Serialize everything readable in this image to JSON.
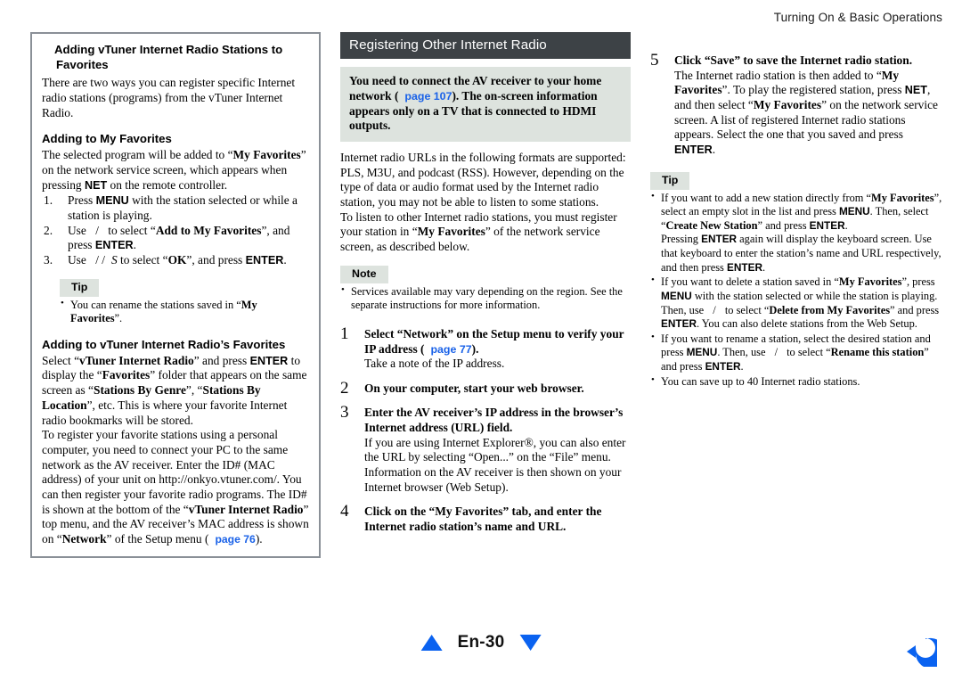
{
  "running_header": "Turning On & Basic Operations",
  "left_column": {
    "heading": "Adding vTuner Internet Radio Stations to Favorites",
    "intro": "There are two ways you can register specific Internet radio stations (programs) from the vTuner Internet Radio.",
    "sub1_heading": "Adding to My Favorites",
    "sub1_intro_a": "The selected program will be added to “",
    "sub1_intro_b": "My Favorites",
    "sub1_intro_c": "” on the network service screen, which appears when pressing ",
    "sub1_intro_d": "NET",
    "sub1_intro_e": " on the remote controller.",
    "steps": [
      {
        "pre": "Press ",
        "kbd": "MENU",
        "post": " with the station selected or while a station is playing."
      },
      {
        "pre": "Use ",
        "arrows": "/",
        "mid": " to select “",
        "bold": "Add to My Favorites",
        "post": "”, and press ",
        "kbd": "ENTER",
        "tail": "."
      },
      {
        "pre": "Use ",
        "arrows": "/ /",
        "arrows2": "S",
        "mid": " to select “",
        "bold": "OK",
        "post": "”, and press ",
        "kbd": "ENTER",
        "tail": "."
      }
    ],
    "tip_badge": "Tip",
    "tip_bullet_a": "You can rename the stations saved in “",
    "tip_bullet_b": "My Favorites",
    "tip_bullet_c": "”.",
    "sub2_heading": "Adding to vTuner Internet Radio’s Favorites",
    "sub2_p1_a": "Select “",
    "sub2_p1_b": "vTuner Internet Radio",
    "sub2_p1_c": "” and press ",
    "sub2_p1_d": "ENTER",
    "sub2_p1_e": " to display the “",
    "sub2_p1_f": "Favorites",
    "sub2_p1_g": "” folder that appears on the same screen as “",
    "sub2_p1_h": "Stations By Genre",
    "sub2_p1_i": "”, “",
    "sub2_p1_j": "Stations By Location",
    "sub2_p1_k": "”, etc. This is where your favorite Internet radio bookmarks will be stored.",
    "sub2_p2_a": "To register your favorite stations using a personal computer, you need to connect your PC to the same network as the AV receiver. Enter the ID# (MAC address) of your unit on http://onkyo.vtuner.com/. You can then register your favorite radio programs. The ID# is shown at the bottom of the “",
    "sub2_p2_b": "vTuner Internet Radio",
    "sub2_p2_c": "” top menu, and the AV receiver’s MAC address is shown on “",
    "sub2_p2_d": "Network",
    "sub2_p2_e": "” of the Setup menu (",
    "sub2_p2_link": "page 76",
    "sub2_p2_f": ")."
  },
  "middle_column": {
    "title_bar": "Registering Other Internet Radio",
    "callout_a": "You need to connect the AV receiver to your home network (",
    "callout_link": "page 107",
    "callout_b": "). The on-screen information appears only on a TV that is connected to HDMI outputs.",
    "para1": "Internet radio URLs in the following formats are supported: PLS, M3U, and podcast (RSS). However, depending on the type of data or audio format used by the Internet radio station, you may not be able to listen to some stations.",
    "para2_a": "To listen to other Internet radio stations, you must register your station in “",
    "para2_b": "My Favorites",
    "para2_c": "” of the network service screen, as described below.",
    "note_badge": "Note",
    "note_bullet": "Services available may vary depending on the region. See the separate instructions for more information.",
    "steps": [
      {
        "title_a": "Select “Network” on the Setup menu to verify your IP address (",
        "title_link": "page 77",
        "title_b": ").",
        "body": "Take a note of the IP address."
      },
      {
        "title_a": "On your computer, start your web browser.",
        "body": ""
      },
      {
        "title_a": "Enter the AV receiver’s IP address in the browser’s Internet address (URL) field.",
        "body": "If you are using Internet Explorer®, you can also enter the URL by selecting “Open...” on the “File” menu.",
        "body2": "Information on the AV receiver is then shown on your Internet browser (Web Setup)."
      },
      {
        "title_a": "Click on the “My Favorites” tab, and enter the Internet radio station’s name and URL.",
        "body": ""
      }
    ]
  },
  "right_column": {
    "step5": {
      "number": "5",
      "title": "Click “Save” to save the Internet radio station.",
      "body_a": "The Internet radio station is then added to “",
      "body_b": "My Favorites",
      "body_c": "”. To play the registered station, press ",
      "body_d": "NET",
      "body_e": ", and then select “",
      "body_f": "My Favorites",
      "body_g": "” on the network service screen. A list of registered Internet radio stations appears. Select the one that you saved and press ",
      "body_h": "ENTER",
      "body_i": "."
    },
    "tip_badge": "Tip",
    "tips": [
      {
        "a": "If you want to add a new station directly from “",
        "b": "My Favorites",
        "c": "”, select an empty slot in the list and press ",
        "d": "MENU",
        "e": ". Then, select “",
        "f": "Create New Station",
        "g": "” and press ",
        "h": "ENTER",
        "i": ".",
        "cont_a": "Pressing ",
        "cont_b": "ENTER",
        "cont_c": " again will display the keyboard screen. Use that keyboard to enter the station’s name and URL respectively, and then press ",
        "cont_d": "ENTER",
        "cont_e": "."
      },
      {
        "a": "If you want to delete a station saved in “",
        "b": "My Favorites",
        "c": "”, press ",
        "d": "MENU",
        "e": " with the station selected or while the station is playing. Then, use ",
        "arrows": "/",
        "f": " to select “",
        "g": "Delete from My Favorites",
        "h": "” and press ",
        "i": "ENTER",
        "j": ". You can also delete stations from the Web Setup."
      },
      {
        "a": "If you want to rename a station, select the desired station and press ",
        "b": "MENU",
        "c": ". Then, use ",
        "arrows": "/",
        "d": " to select “",
        "e": "Rename this station",
        "f": "” and press ",
        "g": "ENTER",
        "h": "."
      },
      {
        "a": "You can save up to 40 Internet radio stations."
      }
    ]
  },
  "footer": {
    "page_number": "En-30",
    "prev_icon": "triangle-up-icon",
    "next_icon": "triangle-down-icon",
    "return_icon": "return-arrow-icon"
  },
  "colors": {
    "title_bar_bg": "#3d4246",
    "callout_bg": "#dde3de",
    "badge_bg": "#dde3de",
    "link": "#1a62e8",
    "nav_blue": "#0a62f0",
    "box_border": "#8a9097"
  }
}
